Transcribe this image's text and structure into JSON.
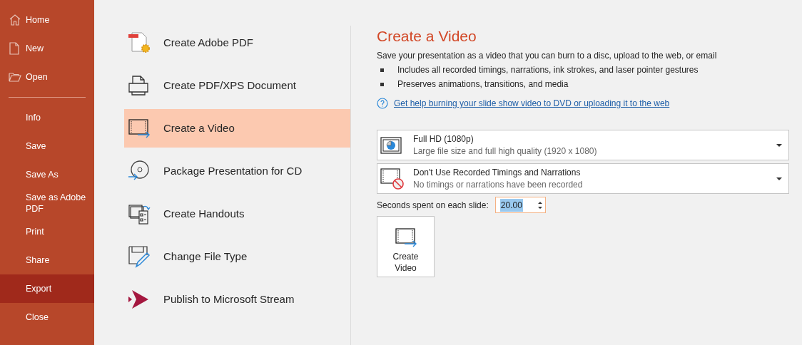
{
  "sidebar": {
    "items": [
      {
        "label": "Home",
        "kind": "home",
        "selected": false
      },
      {
        "label": "New",
        "kind": "new",
        "selected": false
      },
      {
        "label": "Open",
        "kind": "open",
        "selected": false
      },
      {
        "label": "Info",
        "selected": false
      },
      {
        "label": "Save",
        "selected": false
      },
      {
        "label": "Save As",
        "selected": false
      },
      {
        "label": "Save as Adobe PDF",
        "selected": false
      },
      {
        "label": "Print",
        "selected": false
      },
      {
        "label": "Share",
        "selected": false
      },
      {
        "label": "Export",
        "selected": true
      },
      {
        "label": "Close",
        "selected": false
      }
    ]
  },
  "export_options": [
    {
      "label": "Create Adobe PDF",
      "kind": "pdf",
      "selected": false
    },
    {
      "label": "Create PDF/XPS Document",
      "kind": "xps",
      "selected": false
    },
    {
      "label": "Create a Video",
      "kind": "video",
      "selected": true
    },
    {
      "label": "Package Presentation for CD",
      "kind": "cd",
      "selected": false
    },
    {
      "label": "Create Handouts",
      "kind": "handouts",
      "selected": false
    },
    {
      "label": "Change File Type",
      "kind": "filetype",
      "selected": false
    },
    {
      "label": "Publish to Microsoft Stream",
      "kind": "stream",
      "selected": false
    }
  ],
  "detail": {
    "title": "Create a Video",
    "description": "Save your presentation as a video that you can burn to a disc, upload to the web, or email",
    "bullets": [
      "Includes all recorded timings, narrations, ink strokes, and laser pointer gestures",
      "Preserves animations, transitions, and media"
    ],
    "help_link": "Get help burning your slide show video to DVD or uploading it to the web",
    "dropdowns": [
      {
        "kind": "quality",
        "title": "Full HD (1080p)",
        "subtitle": "Large file size and full high quality (1920 x 1080)"
      },
      {
        "kind": "timings",
        "title": "Don't Use Recorded Timings and Narrations",
        "subtitle": "No timings or narrations have been recorded"
      }
    ],
    "seconds_label": "Seconds spent on each slide:",
    "seconds_value": "20.00",
    "create_button": "Create Video"
  }
}
